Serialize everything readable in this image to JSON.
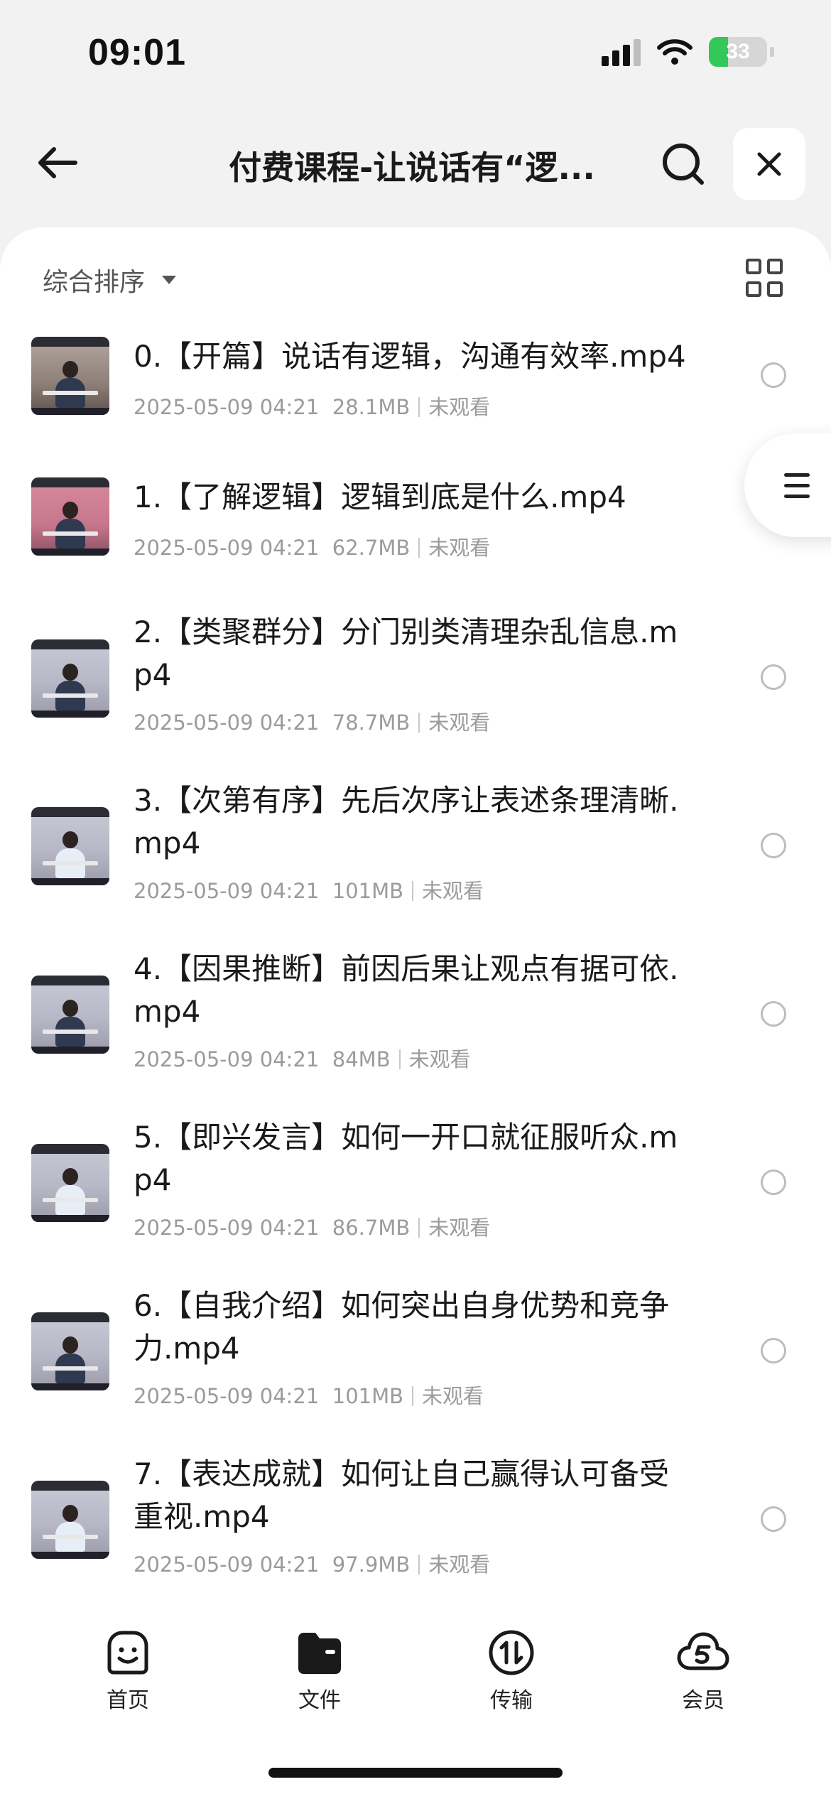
{
  "status_bar": {
    "time": "09:01",
    "battery": "33",
    "battery_level": 0.33,
    "icons": [
      "cellular-signal-icon",
      "wifi-icon",
      "battery-charging-icon"
    ]
  },
  "header": {
    "title": "付费课程-让说话有“逻...",
    "icons": [
      "back-arrow-icon",
      "search-icon",
      "close-icon"
    ]
  },
  "toolbar": {
    "sort_label": "综合排序",
    "icons": [
      "caret-down-icon",
      "grid-view-icon"
    ]
  },
  "files": [
    {
      "name": "0.【开篇】说话有逻辑，沟通有效率.mp4",
      "date": "2025-05-09 04:21",
      "size": "28.1MB",
      "status": "未观看"
    },
    {
      "name": "1.【了解逻辑】逻辑到底是什么.mp4",
      "date": "2025-05-09 04:21",
      "size": "62.7MB",
      "status": "未观看"
    },
    {
      "name": "2.【类聚群分】分门别类清理杂乱信息.mp4",
      "date": "2025-05-09 04:21",
      "size": "78.7MB",
      "status": "未观看"
    },
    {
      "name": "3.【次第有序】先后次序让表述条理清晰.mp4",
      "date": "2025-05-09 04:21",
      "size": "101MB",
      "status": "未观看"
    },
    {
      "name": "4.【因果推断】前因后果让观点有据可依.mp4",
      "date": "2025-05-09 04:21",
      "size": "84MB",
      "status": "未观看"
    },
    {
      "name": "5.【即兴发言】如何一开口就征服听众.mp4",
      "date": "2025-05-09 04:21",
      "size": "86.7MB",
      "status": "未观看"
    },
    {
      "name": "6.【自我介绍】如何突出自身优势和竞争力.mp4",
      "date": "2025-05-09 04:21",
      "size": "101MB",
      "status": "未观看"
    },
    {
      "name": "7.【表达成就】如何让自己赢得认可备受重视.mp4",
      "date": "2025-05-09 04:21",
      "size": "97.9MB",
      "status": "未观看"
    }
  ],
  "float_menu": {
    "icon": "menu-lines-icon"
  },
  "tabbar": {
    "tabs": [
      {
        "label": "首页",
        "icon": "smiley-home-icon"
      },
      {
        "label": "文件",
        "icon": "folder-icon"
      },
      {
        "label": "传输",
        "icon": "transfer-icon"
      },
      {
        "label": "会员",
        "icon": "cloud-vip-icon"
      }
    ]
  }
}
